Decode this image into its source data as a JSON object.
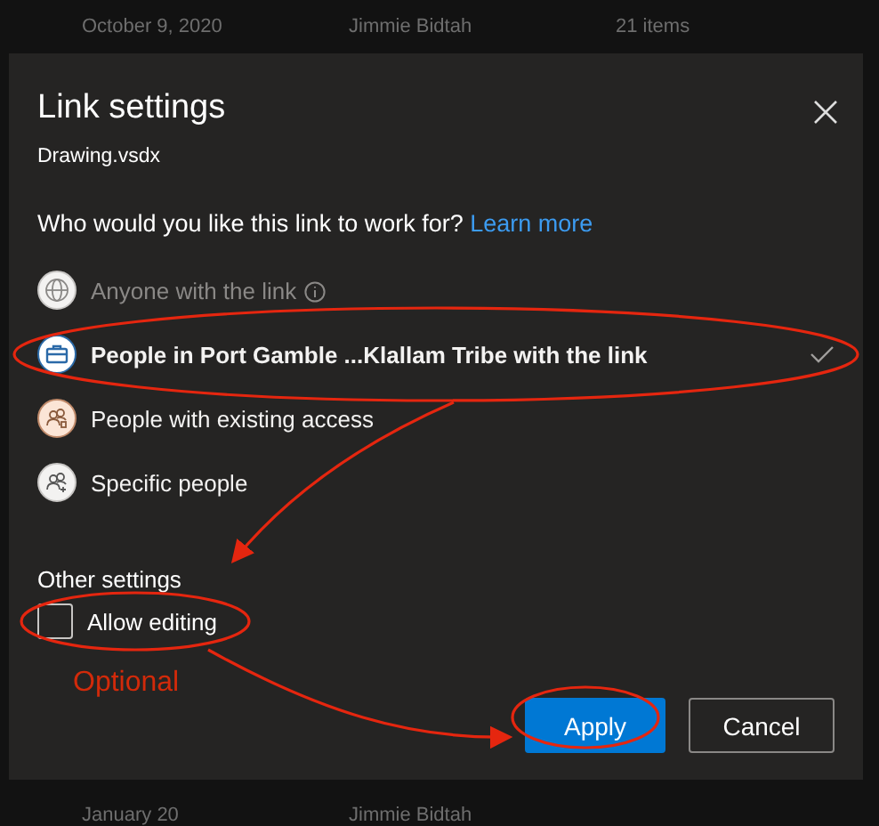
{
  "background_rows": [
    {
      "date": "October 9, 2020",
      "owner": "Jimmie Bidtah",
      "items": "21 items"
    },
    {
      "date": "January 20",
      "owner": "Jimmie Bidtah"
    }
  ],
  "dialog": {
    "title": "Link settings",
    "file_name": "Drawing.vsdx",
    "question": "Who would you like this link to work for?",
    "learn_more": "Learn more",
    "options": [
      {
        "kind": "anyone",
        "label": "Anyone with the link",
        "info": true,
        "disabled": true,
        "selected": false
      },
      {
        "kind": "organization",
        "label": "People in Port Gamble ...Klallam Tribe with the link",
        "info": false,
        "disabled": false,
        "selected": true
      },
      {
        "kind": "existing",
        "label": "People with existing access",
        "info": false,
        "disabled": false,
        "selected": false
      },
      {
        "kind": "specific",
        "label": "Specific people",
        "info": false,
        "disabled": false,
        "selected": false
      }
    ],
    "other_settings": {
      "heading": "Other settings",
      "allow_editing": {
        "label": "Allow editing",
        "checked": false
      }
    },
    "buttons": [
      {
        "kind": "primary",
        "label": "Apply"
      },
      {
        "kind": "secondary",
        "label": "Cancel"
      }
    ]
  },
  "annotation": {
    "label": "Optional"
  }
}
